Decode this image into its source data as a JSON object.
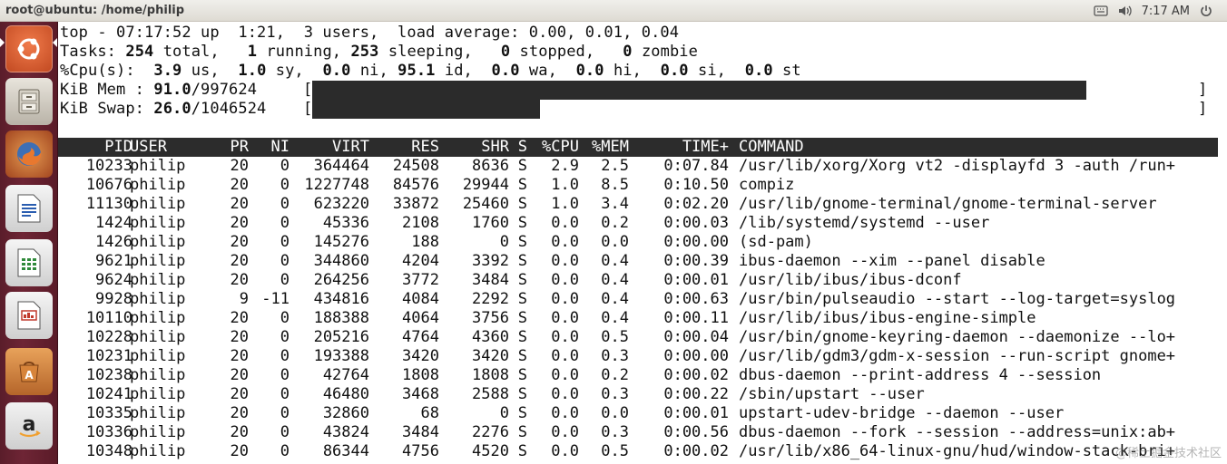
{
  "window": {
    "title": "root@ubuntu: /home/philip"
  },
  "tray": {
    "time": "7:17 AM",
    "icons": [
      "keyboard-icon",
      "volume-icon",
      "power-icon"
    ]
  },
  "launcher": {
    "items": [
      "ubuntu-dash-icon",
      "files-icon",
      "firefox-icon",
      "writer-icon",
      "calc-icon",
      "impress-icon",
      "software-center-icon",
      "amazon-icon"
    ]
  },
  "summary": {
    "top": {
      "text": "top - 07:17:52 up  1:21,  3 users,  load average: 0.00, 0.01, 0.04"
    },
    "tasks": {
      "label": "Tasks:",
      "total": "254",
      "total_label": "total,",
      "running": "1",
      "running_label": "running,",
      "sleeping": "253",
      "sleeping_label": "sleeping,",
      "stopped": "0",
      "stopped_label": "stopped,",
      "zombie": "0",
      "zombie_label": "zombie"
    },
    "cpu": {
      "label": "%Cpu(s):",
      "us": "3.9",
      "us_label": "us,",
      "sy": "1.0",
      "sy_label": "sy,",
      "ni": "0.0",
      "ni_label": "ni,",
      "id": "95.1",
      "id_label": "id,",
      "wa": "0.0",
      "wa_label": "wa,",
      "hi": "0.0",
      "hi_label": "hi,",
      "si": "0.0",
      "si_label": "si,",
      "st": "0.0",
      "st_label": "st"
    },
    "mem": {
      "label": "KiB Mem :",
      "used": "91.0",
      "total": "/997624",
      "open": "[",
      "close": "]",
      "usage_fraction": 0.91
    },
    "swap": {
      "label": "KiB Swap:",
      "used": "26.0",
      "total": "/1046524",
      "open": "[",
      "close": "]",
      "usage_fraction": 0.26
    }
  },
  "columns": [
    "PID",
    "USER",
    "PR",
    "NI",
    "VIRT",
    "RES",
    "SHR",
    "S",
    "%CPU",
    "%MEM",
    "TIME+",
    "COMMAND"
  ],
  "processes": [
    [
      "10233",
      "philip",
      "20",
      "0",
      "364464",
      "24508",
      "8636",
      "S",
      "2.9",
      "2.5",
      "0:07.84",
      "/usr/lib/xorg/Xorg vt2 -displayfd 3 -auth /run+"
    ],
    [
      "10676",
      "philip",
      "20",
      "0",
      "1227748",
      "84576",
      "29944",
      "S",
      "1.0",
      "8.5",
      "0:10.50",
      "compiz"
    ],
    [
      "11130",
      "philip",
      "20",
      "0",
      "623220",
      "33872",
      "25460",
      "S",
      "1.0",
      "3.4",
      "0:02.20",
      "/usr/lib/gnome-terminal/gnome-terminal-server"
    ],
    [
      "1424",
      "philip",
      "20",
      "0",
      "45336",
      "2108",
      "1760",
      "S",
      "0.0",
      "0.2",
      "0:00.03",
      "/lib/systemd/systemd --user"
    ],
    [
      "1426",
      "philip",
      "20",
      "0",
      "145276",
      "188",
      "0",
      "S",
      "0.0",
      "0.0",
      "0:00.00",
      "(sd-pam)"
    ],
    [
      "9621",
      "philip",
      "20",
      "0",
      "344860",
      "4204",
      "3392",
      "S",
      "0.0",
      "0.4",
      "0:00.39",
      "ibus-daemon --xim --panel disable"
    ],
    [
      "9624",
      "philip",
      "20",
      "0",
      "264256",
      "3772",
      "3484",
      "S",
      "0.0",
      "0.4",
      "0:00.01",
      "/usr/lib/ibus/ibus-dconf"
    ],
    [
      "9928",
      "philip",
      "9",
      "-11",
      "434816",
      "4084",
      "2292",
      "S",
      "0.0",
      "0.4",
      "0:00.63",
      "/usr/bin/pulseaudio --start --log-target=syslog"
    ],
    [
      "10110",
      "philip",
      "20",
      "0",
      "188388",
      "4064",
      "3756",
      "S",
      "0.0",
      "0.4",
      "0:00.11",
      "/usr/lib/ibus/ibus-engine-simple"
    ],
    [
      "10228",
      "philip",
      "20",
      "0",
      "205216",
      "4764",
      "4360",
      "S",
      "0.0",
      "0.5",
      "0:00.04",
      "/usr/bin/gnome-keyring-daemon --daemonize --lo+"
    ],
    [
      "10231",
      "philip",
      "20",
      "0",
      "193388",
      "3420",
      "3420",
      "S",
      "0.0",
      "0.3",
      "0:00.00",
      "/usr/lib/gdm3/gdm-x-session --run-script gnome+"
    ],
    [
      "10238",
      "philip",
      "20",
      "0",
      "42764",
      "1808",
      "1808",
      "S",
      "0.0",
      "0.2",
      "0:00.02",
      "dbus-daemon --print-address 4 --session"
    ],
    [
      "10241",
      "philip",
      "20",
      "0",
      "46480",
      "3468",
      "2588",
      "S",
      "0.0",
      "0.3",
      "0:00.22",
      "/sbin/upstart --user"
    ],
    [
      "10335",
      "philip",
      "20",
      "0",
      "32860",
      "68",
      "0",
      "S",
      "0.0",
      "0.0",
      "0:00.01",
      "upstart-udev-bridge --daemon --user"
    ],
    [
      "10336",
      "philip",
      "20",
      "0",
      "43824",
      "3484",
      "2276",
      "S",
      "0.0",
      "0.3",
      "0:00.56",
      "dbus-daemon --fork --session --address=unix:ab+"
    ],
    [
      "10348",
      "philip",
      "20",
      "0",
      "86344",
      "4756",
      "4520",
      "S",
      "0.0",
      "0.5",
      "0:00.02",
      "/usr/lib/x86_64-linux-gnu/hud/window-stack-bri+"
    ]
  ],
  "watermark": "@稀土掘金技术社区"
}
